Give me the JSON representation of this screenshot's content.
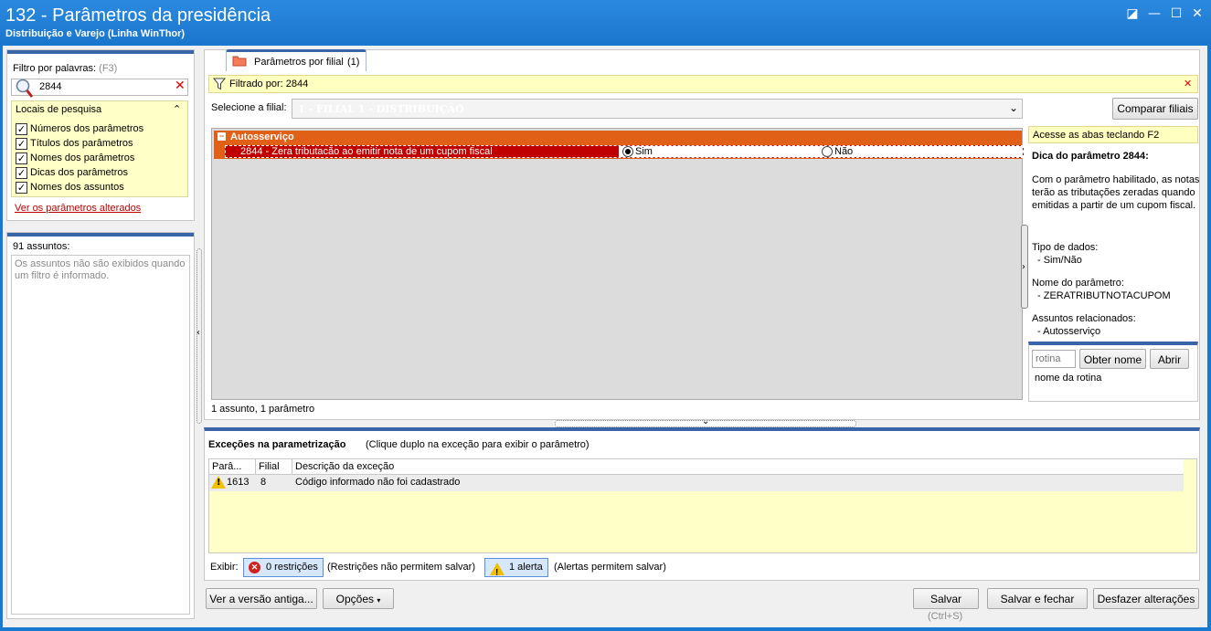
{
  "window": {
    "title": "132 - Parâmetros da presidência",
    "subtitle": "Distribuição e Varejo (Linha WinThor)",
    "controls": [
      "◪",
      "—",
      "☐",
      "✕"
    ]
  },
  "left": {
    "filter_label": "Filtro por palavras:",
    "filter_shortcut": "(F3)",
    "search_value": "2844",
    "locais_title": "Locais de pesquisa",
    "checkboxes": [
      {
        "label": "Números dos parâmetros",
        "checked": true
      },
      {
        "label": "Títulos dos parâmetros",
        "checked": true
      },
      {
        "label": "Nomes dos parâmetros",
        "checked": true
      },
      {
        "label": "Dicas dos parâmetros",
        "checked": true
      },
      {
        "label": "Nomes dos assuntos",
        "checked": true
      }
    ],
    "changed_link": "Ver os parâmetros alterados",
    "subjects_count": "91 assuntos:",
    "subjects_note": "Os assuntos não são exibidos quando um filtro é informado."
  },
  "main": {
    "tab_label": "Parâmetros por filial",
    "tab_count": "(1)",
    "filtered_by": "Filtrado por: 2844",
    "select_branch_label": "Selecione a filial:",
    "branch_value": "1 - FILIAL 1 - DISTRIBUIÇÃO",
    "compare_button": "Comparar filiais",
    "group_name": "Autosserviço",
    "param_label": "2844 - Zera tributacão ao emitir nota de um cupom fiscal",
    "option_yes": "Sim",
    "option_no": "Não",
    "selected_option": "Sim",
    "summary": "1 assunto, 1 parâmetro"
  },
  "hint": {
    "tab_tip": "Acesse as abas teclando F2",
    "title": "Dica do parâmetro 2844:",
    "description": "Com o parâmetro habilitado, as notas terão as tributações zeradas quando emitidas a partir de um cupom fiscal.",
    "data_type_label": "Tipo de dados:",
    "data_type_value": "- Sim/Não",
    "param_name_label": "Nome do parâmetro:",
    "param_name_value": "- ZERATRIBUTNOTACUPOM",
    "related_label": "Assuntos relacionados:",
    "related_value": "- Autosserviço",
    "rotina_placeholder": "rotina",
    "get_name_button": "Obter nome",
    "open_button": "Abrir",
    "rotina_name": "nome da rotina"
  },
  "exceptions": {
    "title": "Exceções na parametrização",
    "hint": "(Clique duplo na exceção para exibir o parâmetro)",
    "columns": [
      "Parâ...",
      "Filial",
      "Descrição da exceção"
    ],
    "rows": [
      {
        "param": "1613",
        "filial": "8",
        "description": "Código informado não foi cadastrado"
      }
    ],
    "show_label": "Exibir:",
    "restrictions_button": "0 restrições",
    "restrictions_note": "(Restrições não permitem salvar)",
    "alerts_button": "1 alerta",
    "alerts_note": "(Alertas permitem salvar)"
  },
  "footer": {
    "old_version_button": "Ver a versão antiga...",
    "options_button": "Opções",
    "save_button": "Salvar",
    "save_shortcut": "(Ctrl+S)",
    "save_close_button": "Salvar e fechar",
    "undo_button": "Desfazer alterações"
  },
  "colors": {
    "titlebar": "#1a76cc",
    "group_row": "#e06018",
    "selected_row": "#c00000",
    "accent": "#3a64a8",
    "info_yellow": "#ffffc0"
  }
}
